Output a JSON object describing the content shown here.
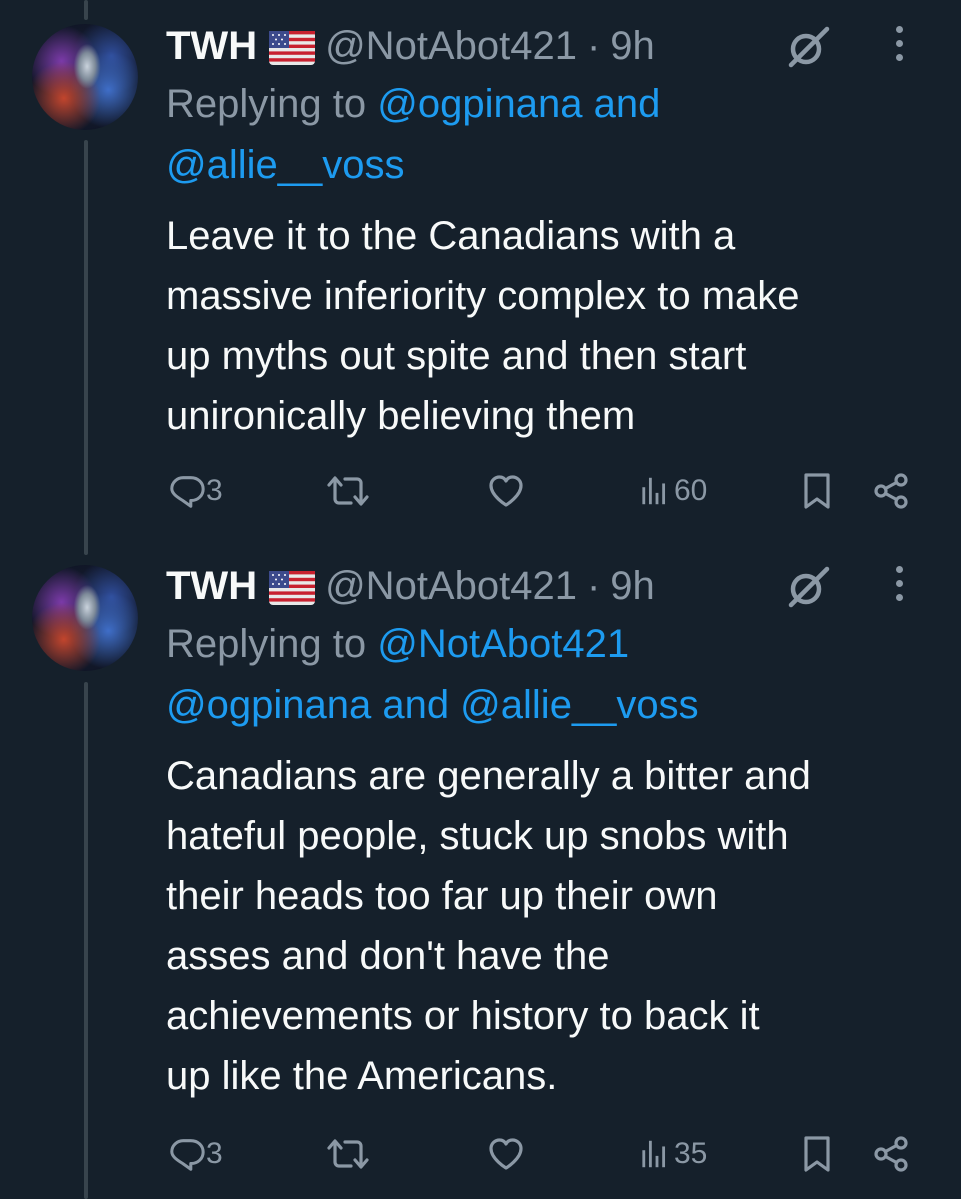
{
  "theme": {
    "background": "#15202b",
    "text": "#f7f9f9",
    "muted": "#8b98a5",
    "link": "#1d9bf0",
    "thread_line": "#38444d"
  },
  "tweets": [
    {
      "display_name": "TWH",
      "flag": "us-flag-emoji",
      "handle": "@NotAbot421",
      "separator": "·",
      "time": "9h",
      "reply_prefix": "Replying to",
      "reply_line1_link": "@ogpinana and",
      "reply_line2_link": "@allie__voss",
      "body_lines": [
        "Leave it to the Canadians with a",
        "massive inferiority complex to make",
        "up myths out spite and then start",
        "unironically believing them"
      ],
      "replies": "3",
      "retweets": "",
      "likes": "",
      "views": "60"
    },
    {
      "display_name": "TWH",
      "flag": "us-flag-emoji",
      "handle": "@NotAbot421",
      "separator": "·",
      "time": "9h",
      "reply_prefix": "Replying to",
      "reply_line1_link": "@NotAbot421",
      "reply_line2_link": "@ogpinana and @allie__voss",
      "body_lines": [
        "Canadians are generally a bitter and",
        "hateful people, stuck up snobs with",
        "their heads too far up their own",
        "asses and don't have the",
        "achievements or history to back it",
        "up like the Americans."
      ],
      "replies": "3",
      "retweets": "",
      "likes": "",
      "views": "35"
    }
  ]
}
